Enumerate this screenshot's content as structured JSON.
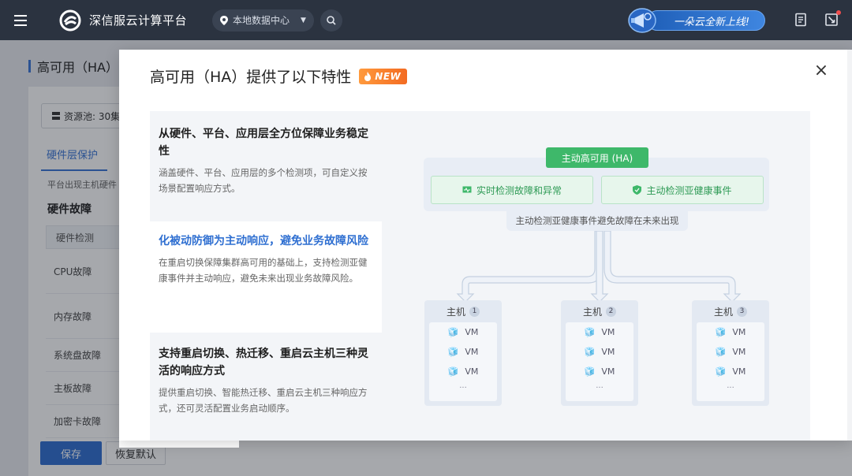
{
  "header": {
    "app_name": "深信服云计算平台",
    "datacenter": "本地数据中心",
    "promo_text": "一朵云全新上线!"
  },
  "page": {
    "title": "高可用（HA）",
    "resource_pool": "资源池: 30集",
    "tab_label": "硬件层保护",
    "description": "平台出现主机硬件",
    "section_title": "硬件故障",
    "table_header": "硬件检测",
    "rows": [
      "CPU故障",
      "内存故障",
      "系统盘故障",
      "主板故障",
      "加密卡故障"
    ],
    "save_label": "保存",
    "reset_label": "恢复默认"
  },
  "modal": {
    "title": "高可用（HA）提供了以下特性",
    "badge": "NEW",
    "features": [
      {
        "title": "从硬件、平台、应用层全方位保障业务稳定性",
        "desc": "涵盖硬件、平台、应用层的多个检测项，可自定义按场景配置响应方式。"
      },
      {
        "title": "化被动防御为主动响应，避免业务故障风险",
        "desc": "在重启切换保障集群高可用的基础上，支持检测亚健康事件并主动响应，避免未来出现业务故障风险。"
      },
      {
        "title": "支持重启切换、热迁移、重启云主机三种灵活的响应方式",
        "desc": "提供重启切换、智能热迁移、重启云主机三种响应方式，还可灵活配置业务启动顺序。"
      }
    ],
    "diagram": {
      "ha_label": "主动高可用 (HA)",
      "left_item": "实时检测故障和异常",
      "right_item": "主动检测亚健康事件",
      "caption": "主动检测亚健康事件避免故障在未来出现",
      "host_label": "主机",
      "hosts": [
        "1",
        "2",
        "3"
      ],
      "vm_label": "VM",
      "more": "..."
    }
  },
  "colors": {
    "accent": "#2f6fd1",
    "green": "#3eb86a",
    "badge": "#f36b22",
    "topbar": "#2b3340"
  }
}
